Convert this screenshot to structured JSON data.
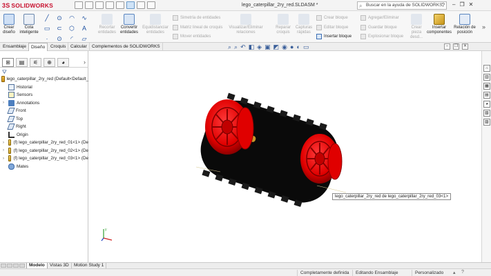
{
  "app": {
    "brand_prefix": "3S",
    "brand": "SOLIDWORKS",
    "document_title": "lego_caterpillar_2ry_red.SLDASM *",
    "help_search_placeholder": "Buscar en la ayuda de SOLIDWORKS",
    "accent_color": "#c8102e"
  },
  "ribbon": {
    "create_drawing": "Crear diseño",
    "smart_dimension": "Cota inteligente",
    "trim_entities": "Recortar entidades",
    "convert_entities": "Convertir entidades",
    "offset_entities": "Equidistanciar entidades",
    "mirror_entities": "Simetría de entidades",
    "linear_pattern": "Matriz lineal de croquis",
    "move_entities": "Mover entidades",
    "display_relations": "Visualizar/Eliminar relaciones",
    "repair_sketch": "Reparar croquis",
    "quick_snaps": "Capturas rápidas",
    "create_block": "Crear bloque",
    "edit_block": "Editar bloque",
    "insert_block": "Insertar bloque",
    "add_remove": "Agregar/Eliminar",
    "save_block": "Guardar bloque",
    "explode_block": "Explosionar bloque",
    "create_part_from_block": "Crear pieza desd...",
    "insert_components": "Insertar componentes",
    "position_relation": "Relación de posición"
  },
  "tabs": {
    "assembly": "Ensamblaje",
    "design": "Diseño",
    "sketch": "Croquis",
    "evaluate": "Calcular",
    "addins": "Complementos de SOLIDWORKS"
  },
  "tree": {
    "root": "lego_caterpillar_2ry_red  (Default<Default_",
    "history": "Historial",
    "sensors": "Sensors",
    "annotations": "Annotations",
    "front": "Front",
    "top": "Top",
    "right": "Right",
    "origin": "Origin",
    "part1": "(f) lego_caterpillar_2ry_red_01<1> (De",
    "part2": "(f) lego_caterpillar_2ry_red_02<1> (De",
    "part3": "(f) lego_caterpillar_2ry_red_03<1> (De",
    "mates": "Mates"
  },
  "graphics": {
    "tooltip": "lego_caterpillar_2ry_red de lego_caterpillar_2ry_red_03<1>",
    "wheel_color": "#e00000",
    "belt_color": "#0a0a0a",
    "axle_color": "#c8962a"
  },
  "bottom_tabs": {
    "model": "Modelo",
    "view3d": "Vistas 3D",
    "motion": "Motion Study 1"
  },
  "status": {
    "defined": "Completamente definida",
    "editing": "Editando Ensamblaje",
    "custom": "Personalizado"
  }
}
